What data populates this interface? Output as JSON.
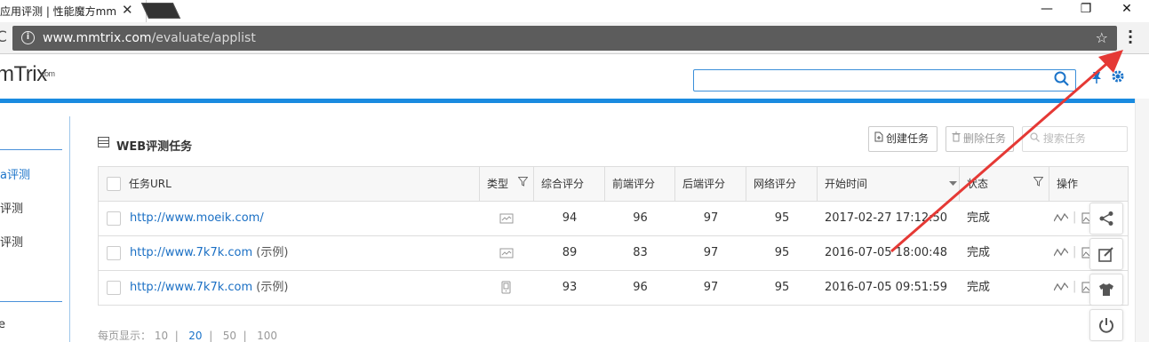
{
  "browser": {
    "tab_title": "应用评测 | 性能魔方mm",
    "tab_close": "✕",
    "window_controls": {
      "minimize": "—",
      "maximize": "❐",
      "close": "✕"
    },
    "url_host": "www.mmtrix.com",
    "url_path": "/evaluate/applist",
    "reload": "C",
    "info": "i",
    "star": "☆",
    "menu": "⋮"
  },
  "header": {
    "logo": "mTrix",
    "logo_sup": "com",
    "search_placeholder": ""
  },
  "sidebar": {
    "items": [
      {
        "label": "a评测",
        "active": true
      },
      {
        "label": "评测"
      },
      {
        "label": "评测"
      }
    ],
    "bottom": "e"
  },
  "section": {
    "title": "WEB评测任务",
    "create_btn": "创建任务",
    "delete_btn": "删除任务",
    "search_placeholder": "搜索任务"
  },
  "table": {
    "columns": [
      "任务URL",
      "类型",
      "综合评分",
      "前端评分",
      "后端评分",
      "网络评分",
      "开始时间",
      "状态",
      "操作"
    ],
    "rows": [
      {
        "url": "http://www.moeik.com/",
        "suffix": "",
        "overall": "94",
        "front": "96",
        "back": "97",
        "net": "95",
        "start": "2017-02-27 17:12:50",
        "status": "完成"
      },
      {
        "url": "http://www.7k7k.com",
        "suffix": " (示例)",
        "overall": "89",
        "front": "83",
        "back": "97",
        "net": "95",
        "start": "2016-07-05 18:00:48",
        "status": "完成"
      },
      {
        "url": "http://www.7k7k.com",
        "suffix": " (示例)",
        "overall": "93",
        "front": "96",
        "back": "97",
        "net": "95",
        "start": "2016-07-05 09:51:59",
        "status": "完成"
      }
    ]
  },
  "pager": {
    "label": "每页显示：",
    "sizes": [
      "10",
      "20",
      "50",
      "100"
    ],
    "selected": "20"
  },
  "colors": {
    "accent": "#1a8be0",
    "link": "#1a6fc4",
    "annotation": "#e53935"
  }
}
